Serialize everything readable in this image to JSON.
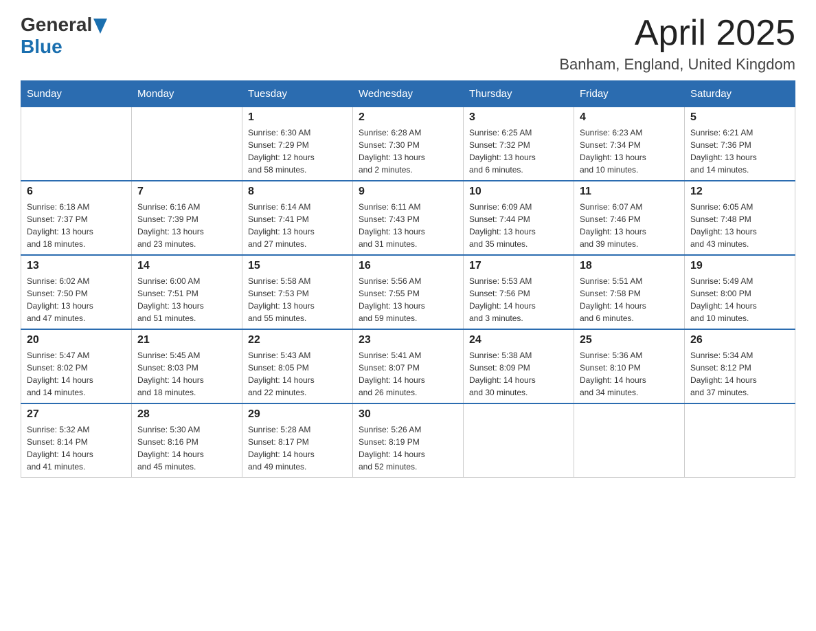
{
  "header": {
    "logo_general": "General",
    "logo_blue": "Blue",
    "title": "April 2025",
    "subtitle": "Banham, England, United Kingdom"
  },
  "days_of_week": [
    "Sunday",
    "Monday",
    "Tuesday",
    "Wednesday",
    "Thursday",
    "Friday",
    "Saturday"
  ],
  "weeks": [
    [
      {
        "day": "",
        "info": ""
      },
      {
        "day": "",
        "info": ""
      },
      {
        "day": "1",
        "info": "Sunrise: 6:30 AM\nSunset: 7:29 PM\nDaylight: 12 hours\nand 58 minutes."
      },
      {
        "day": "2",
        "info": "Sunrise: 6:28 AM\nSunset: 7:30 PM\nDaylight: 13 hours\nand 2 minutes."
      },
      {
        "day": "3",
        "info": "Sunrise: 6:25 AM\nSunset: 7:32 PM\nDaylight: 13 hours\nand 6 minutes."
      },
      {
        "day": "4",
        "info": "Sunrise: 6:23 AM\nSunset: 7:34 PM\nDaylight: 13 hours\nand 10 minutes."
      },
      {
        "day": "5",
        "info": "Sunrise: 6:21 AM\nSunset: 7:36 PM\nDaylight: 13 hours\nand 14 minutes."
      }
    ],
    [
      {
        "day": "6",
        "info": "Sunrise: 6:18 AM\nSunset: 7:37 PM\nDaylight: 13 hours\nand 18 minutes."
      },
      {
        "day": "7",
        "info": "Sunrise: 6:16 AM\nSunset: 7:39 PM\nDaylight: 13 hours\nand 23 minutes."
      },
      {
        "day": "8",
        "info": "Sunrise: 6:14 AM\nSunset: 7:41 PM\nDaylight: 13 hours\nand 27 minutes."
      },
      {
        "day": "9",
        "info": "Sunrise: 6:11 AM\nSunset: 7:43 PM\nDaylight: 13 hours\nand 31 minutes."
      },
      {
        "day": "10",
        "info": "Sunrise: 6:09 AM\nSunset: 7:44 PM\nDaylight: 13 hours\nand 35 minutes."
      },
      {
        "day": "11",
        "info": "Sunrise: 6:07 AM\nSunset: 7:46 PM\nDaylight: 13 hours\nand 39 minutes."
      },
      {
        "day": "12",
        "info": "Sunrise: 6:05 AM\nSunset: 7:48 PM\nDaylight: 13 hours\nand 43 minutes."
      }
    ],
    [
      {
        "day": "13",
        "info": "Sunrise: 6:02 AM\nSunset: 7:50 PM\nDaylight: 13 hours\nand 47 minutes."
      },
      {
        "day": "14",
        "info": "Sunrise: 6:00 AM\nSunset: 7:51 PM\nDaylight: 13 hours\nand 51 minutes."
      },
      {
        "day": "15",
        "info": "Sunrise: 5:58 AM\nSunset: 7:53 PM\nDaylight: 13 hours\nand 55 minutes."
      },
      {
        "day": "16",
        "info": "Sunrise: 5:56 AM\nSunset: 7:55 PM\nDaylight: 13 hours\nand 59 minutes."
      },
      {
        "day": "17",
        "info": "Sunrise: 5:53 AM\nSunset: 7:56 PM\nDaylight: 14 hours\nand 3 minutes."
      },
      {
        "day": "18",
        "info": "Sunrise: 5:51 AM\nSunset: 7:58 PM\nDaylight: 14 hours\nand 6 minutes."
      },
      {
        "day": "19",
        "info": "Sunrise: 5:49 AM\nSunset: 8:00 PM\nDaylight: 14 hours\nand 10 minutes."
      }
    ],
    [
      {
        "day": "20",
        "info": "Sunrise: 5:47 AM\nSunset: 8:02 PM\nDaylight: 14 hours\nand 14 minutes."
      },
      {
        "day": "21",
        "info": "Sunrise: 5:45 AM\nSunset: 8:03 PM\nDaylight: 14 hours\nand 18 minutes."
      },
      {
        "day": "22",
        "info": "Sunrise: 5:43 AM\nSunset: 8:05 PM\nDaylight: 14 hours\nand 22 minutes."
      },
      {
        "day": "23",
        "info": "Sunrise: 5:41 AM\nSunset: 8:07 PM\nDaylight: 14 hours\nand 26 minutes."
      },
      {
        "day": "24",
        "info": "Sunrise: 5:38 AM\nSunset: 8:09 PM\nDaylight: 14 hours\nand 30 minutes."
      },
      {
        "day": "25",
        "info": "Sunrise: 5:36 AM\nSunset: 8:10 PM\nDaylight: 14 hours\nand 34 minutes."
      },
      {
        "day": "26",
        "info": "Sunrise: 5:34 AM\nSunset: 8:12 PM\nDaylight: 14 hours\nand 37 minutes."
      }
    ],
    [
      {
        "day": "27",
        "info": "Sunrise: 5:32 AM\nSunset: 8:14 PM\nDaylight: 14 hours\nand 41 minutes."
      },
      {
        "day": "28",
        "info": "Sunrise: 5:30 AM\nSunset: 8:16 PM\nDaylight: 14 hours\nand 45 minutes."
      },
      {
        "day": "29",
        "info": "Sunrise: 5:28 AM\nSunset: 8:17 PM\nDaylight: 14 hours\nand 49 minutes."
      },
      {
        "day": "30",
        "info": "Sunrise: 5:26 AM\nSunset: 8:19 PM\nDaylight: 14 hours\nand 52 minutes."
      },
      {
        "day": "",
        "info": ""
      },
      {
        "day": "",
        "info": ""
      },
      {
        "day": "",
        "info": ""
      }
    ]
  ]
}
